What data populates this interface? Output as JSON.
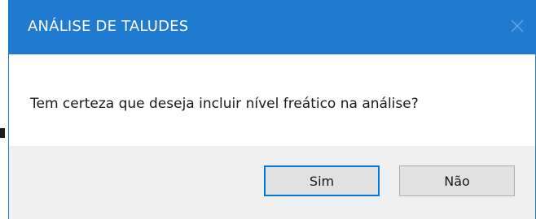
{
  "dialog": {
    "title": "ANÁLISE DE TALUDES",
    "message": "Tem certeza que deseja incluir nível freático na análise?",
    "buttons": {
      "yes_label": "Sim",
      "no_label": "Não"
    },
    "icons": {
      "close": "close-icon"
    },
    "colors": {
      "titlebar": "#1e7bd0",
      "title_text": "#ffffff",
      "footer": "#f0f0f0",
      "button": "#e1e1e1",
      "default_button_border": "#0078d7"
    }
  }
}
